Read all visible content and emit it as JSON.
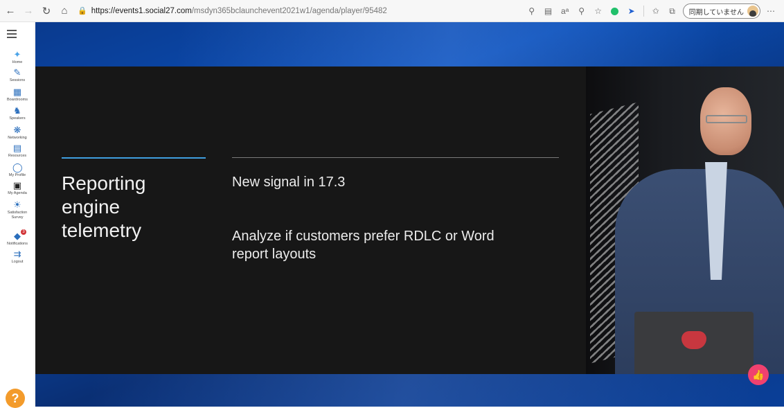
{
  "browser": {
    "url_host": "https://events1.social27.com",
    "url_path": "/msdyn365bclaunchevent2021w1/agenda/player/95482",
    "sync_label": "同期していません",
    "icons": [
      "back-icon",
      "forward-icon",
      "refresh-icon",
      "home-icon",
      "lock-icon",
      "key-icon",
      "immersive-reader-icon",
      "read-aloud-icon",
      "zoom-icon",
      "favorite-add-icon",
      "extension-green-icon",
      "extension-blue-icon",
      "favorites-icon",
      "collections-icon",
      "more-icon"
    ]
  },
  "sidebar": {
    "items": [
      {
        "label": "Home",
        "icon": "home-icon"
      },
      {
        "label": "Sessions",
        "icon": "pen-icon"
      },
      {
        "label": "Boardrooms",
        "icon": "boardroom-icon"
      },
      {
        "label": "Speakers",
        "icon": "speaker-icon"
      },
      {
        "label": "Networking",
        "icon": "networking-icon"
      },
      {
        "label": "Resources",
        "icon": "resources-icon"
      },
      {
        "label": "My Profile",
        "icon": "profile-icon"
      },
      {
        "label": "My Agenda",
        "icon": "calendar-icon"
      },
      {
        "label": "Satisfaction Survey",
        "icon": "survey-icon"
      },
      {
        "label": "Notifications",
        "icon": "bell-icon",
        "badge": "3"
      },
      {
        "label": "Logout",
        "icon": "logout-icon"
      }
    ],
    "help": "?"
  },
  "slide": {
    "title": "Reporting engine telemetry",
    "bullet1": "New signal in 17.3",
    "bullet2": "Analyze if customers prefer RDLC or Word report layouts"
  },
  "colors": {
    "accent_line": "#3f9ee0",
    "slide_bg": "#171717",
    "like": "#f0416f",
    "help": "#f39b2b"
  }
}
